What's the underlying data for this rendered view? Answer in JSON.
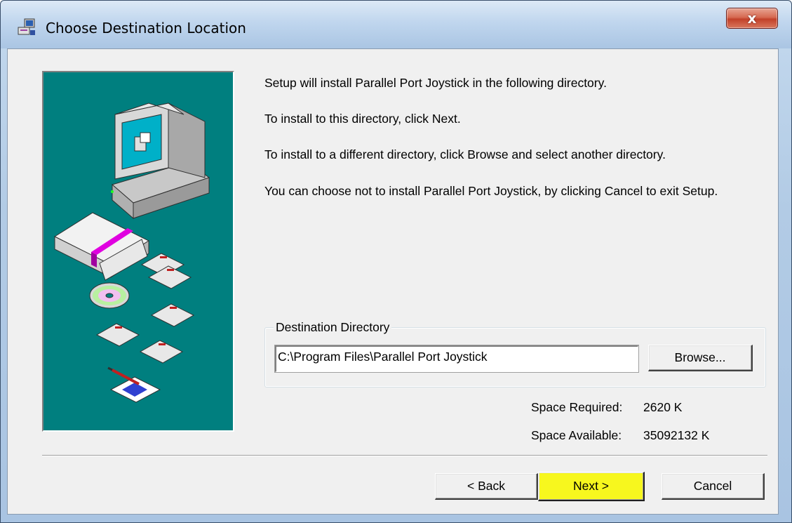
{
  "window": {
    "title": "Choose Destination Location",
    "close_glyph": "x"
  },
  "text": {
    "line1": "Setup will install Parallel Port Joystick in the following directory.",
    "line2": "To install to this directory, click Next.",
    "line3": "To install to a different directory, click Browse and select another directory.",
    "line4": "You can choose not to install Parallel Port Joystick, by clicking Cancel to exit Setup."
  },
  "destination": {
    "group_label": "Destination Directory",
    "path": "C:\\Program Files\\Parallel Port Joystick",
    "browse_label": "Browse..."
  },
  "space": {
    "required_label": "Space Required:",
    "required_value": "2620 K",
    "available_label": "Space Available:",
    "available_value": "35092132 K"
  },
  "buttons": {
    "back": "< Back",
    "next": "Next >",
    "cancel": "Cancel"
  },
  "colors": {
    "art_background": "#007f7f",
    "next_highlight": "#f7f71e",
    "close_button": "#c2412a"
  },
  "icons": [
    "installer-icon",
    "close-icon",
    "computer-icon",
    "box-icon",
    "floppy-disk-icon",
    "cd-icon",
    "notepad-icon"
  ]
}
